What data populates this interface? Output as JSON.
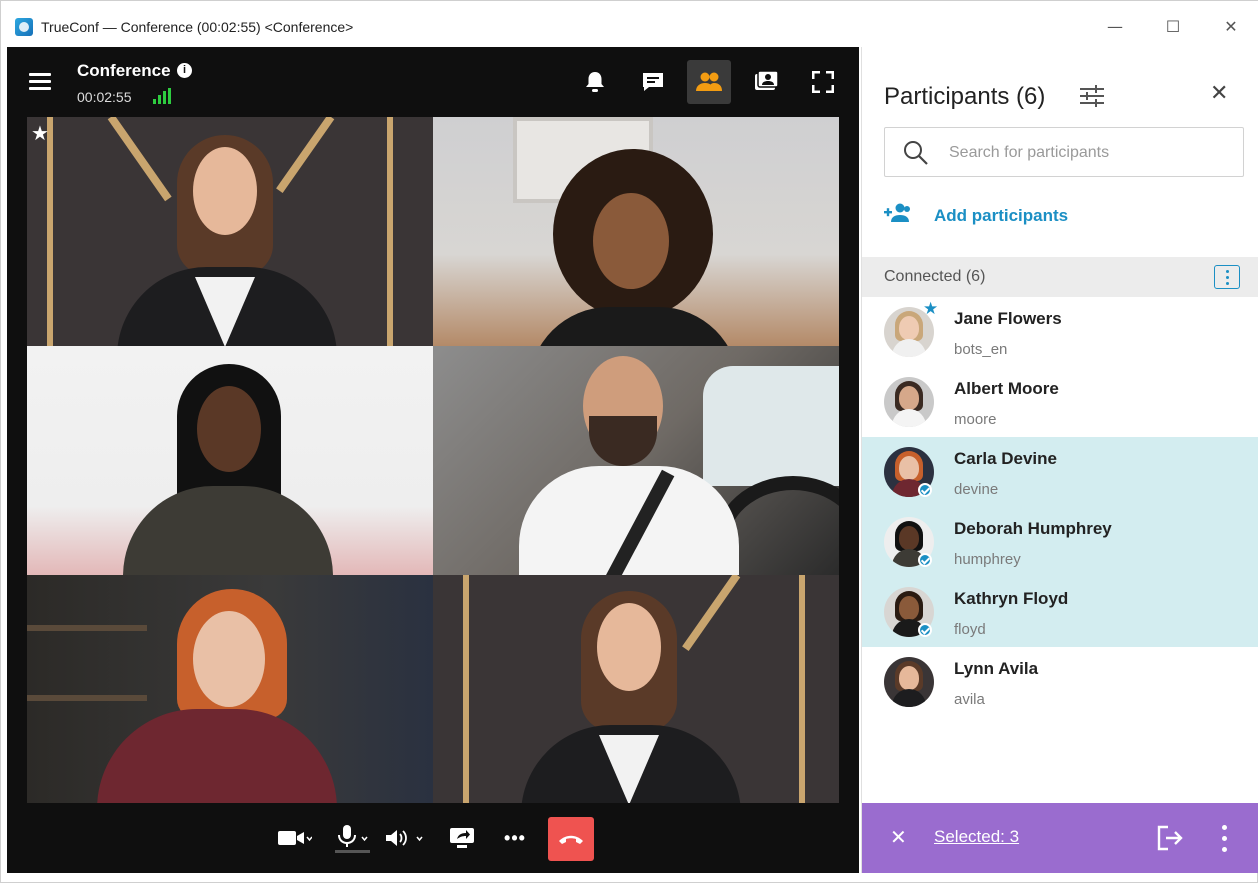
{
  "window": {
    "title": "TrueConf — Conference (00:02:55) <Conference>",
    "minimize": "—",
    "maximize": "☐",
    "close": "✕"
  },
  "conference": {
    "title": "Conference",
    "info": "i",
    "timer": "00:02:55",
    "top_icons": [
      "bell-icon",
      "chat-icon",
      "participants-icon",
      "gallery-icon",
      "fullscreen-icon"
    ],
    "active_icon": "participants-icon",
    "accent": "#f39c12",
    "signal_color": "#2ecc40",
    "star": "★",
    "more_label": "•••"
  },
  "panel": {
    "title": "Participants (6)",
    "close": "✕",
    "search_placeholder": "Search for participants",
    "add_label": "Add participants",
    "section_label": "Connected (6)",
    "accent": "#1b8fc4",
    "participants": [
      {
        "name": "Jane Flowers",
        "login": "bots_en",
        "selected": false,
        "owner": true
      },
      {
        "name": "Albert Moore",
        "login": "moore",
        "selected": false,
        "owner": false
      },
      {
        "name": "Carla Devine",
        "login": "devine",
        "selected": true,
        "owner": false
      },
      {
        "name": "Deborah Humphrey",
        "login": "humphrey",
        "selected": true,
        "owner": false
      },
      {
        "name": "Kathryn Floyd",
        "login": "floyd",
        "selected": true,
        "owner": false
      },
      {
        "name": "Lynn Avila",
        "login": "avila",
        "selected": false,
        "owner": false
      }
    ],
    "footer": {
      "close": "✕",
      "selected_label": "Selected: 3",
      "color": "#9a6ccf"
    }
  }
}
